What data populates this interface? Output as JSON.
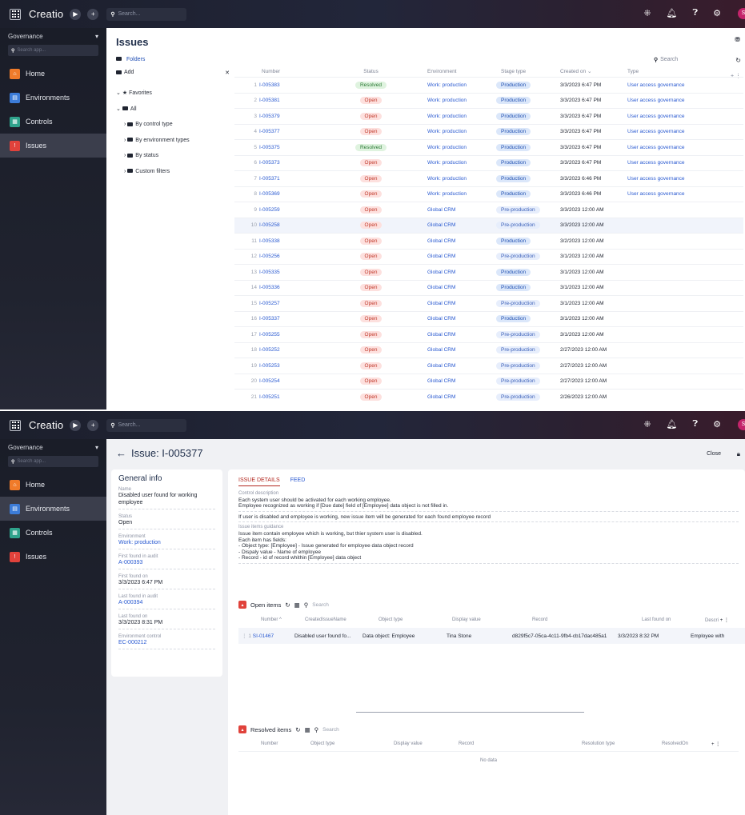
{
  "app": {
    "logo": "Creatio",
    "search_placeholder": "Search...",
    "search_placeholder2": "Search...",
    "avatar": "S"
  },
  "sidebar": {
    "title": "Governance",
    "search_placeholder": "Search app...",
    "items": [
      {
        "label": "Home"
      },
      {
        "label": "Environments"
      },
      {
        "label": "Controls"
      },
      {
        "label": "Issues"
      }
    ]
  },
  "list": {
    "title": "Issues",
    "folders_label": "Folders",
    "add_label": "Add",
    "search_label": "Search",
    "tree": [
      {
        "label": "Favorites"
      },
      {
        "label": "All"
      },
      {
        "label": "By control type"
      },
      {
        "label": "By environment types"
      },
      {
        "label": "By status"
      },
      {
        "label": "Custom filters"
      }
    ],
    "columns": [
      "Number",
      "Status",
      "Environment",
      "Stage type",
      "Created on",
      "Type"
    ],
    "rows": [
      {
        "n": "1",
        "number": "I-005383",
        "status": "Resolved",
        "env": "Work: production",
        "stage": "Production",
        "created": "3/3/2023 6:47 PM",
        "type": "User access governance"
      },
      {
        "n": "2",
        "number": "I-005381",
        "status": "Open",
        "env": "Work: production",
        "stage": "Production",
        "created": "3/3/2023 6:47 PM",
        "type": "User access governance"
      },
      {
        "n": "3",
        "number": "I-005379",
        "status": "Open",
        "env": "Work: production",
        "stage": "Production",
        "created": "3/3/2023 6:47 PM",
        "type": "User access governance"
      },
      {
        "n": "4",
        "number": "I-005377",
        "status": "Open",
        "env": "Work: production",
        "stage": "Production",
        "created": "3/3/2023 6:47 PM",
        "type": "User access governance"
      },
      {
        "n": "5",
        "number": "I-005375",
        "status": "Resolved",
        "env": "Work: production",
        "stage": "Production",
        "created": "3/3/2023 6:47 PM",
        "type": "User access governance"
      },
      {
        "n": "6",
        "number": "I-005373",
        "status": "Open",
        "env": "Work: production",
        "stage": "Production",
        "created": "3/3/2023 6:47 PM",
        "type": "User access governance"
      },
      {
        "n": "7",
        "number": "I-005371",
        "status": "Open",
        "env": "Work: production",
        "stage": "Production",
        "created": "3/3/2023 6:46 PM",
        "type": "User access governance"
      },
      {
        "n": "8",
        "number": "I-005369",
        "status": "Open",
        "env": "Work: production",
        "stage": "Production",
        "created": "3/3/2023 6:46 PM",
        "type": "User access governance"
      },
      {
        "n": "9",
        "number": "I-005259",
        "status": "Open",
        "env": "Global CRM",
        "stage": "Pre-production",
        "created": "3/3/2023 12:00 AM",
        "type": ""
      },
      {
        "n": "10",
        "number": "I-005258",
        "status": "Open",
        "env": "Global CRM",
        "stage": "Pre-production",
        "created": "3/3/2023 12:00 AM",
        "type": ""
      },
      {
        "n": "11",
        "number": "I-005338",
        "status": "Open",
        "env": "Global CRM",
        "stage": "Production",
        "created": "3/2/2023 12:00 AM",
        "type": ""
      },
      {
        "n": "12",
        "number": "I-005256",
        "status": "Open",
        "env": "Global CRM",
        "stage": "Pre-production",
        "created": "3/1/2023 12:00 AM",
        "type": ""
      },
      {
        "n": "13",
        "number": "I-005335",
        "status": "Open",
        "env": "Global CRM",
        "stage": "Production",
        "created": "3/1/2023 12:00 AM",
        "type": ""
      },
      {
        "n": "14",
        "number": "I-005336",
        "status": "Open",
        "env": "Global CRM",
        "stage": "Production",
        "created": "3/1/2023 12:00 AM",
        "type": ""
      },
      {
        "n": "15",
        "number": "I-005257",
        "status": "Open",
        "env": "Global CRM",
        "stage": "Pre-production",
        "created": "3/1/2023 12:00 AM",
        "type": ""
      },
      {
        "n": "16",
        "number": "I-005337",
        "status": "Open",
        "env": "Global CRM",
        "stage": "Production",
        "created": "3/1/2023 12:00 AM",
        "type": ""
      },
      {
        "n": "17",
        "number": "I-005255",
        "status": "Open",
        "env": "Global CRM",
        "stage": "Pre-production",
        "created": "3/1/2023 12:00 AM",
        "type": ""
      },
      {
        "n": "18",
        "number": "I-005252",
        "status": "Open",
        "env": "Global CRM",
        "stage": "Pre-production",
        "created": "2/27/2023 12:00 AM",
        "type": ""
      },
      {
        "n": "19",
        "number": "I-005253",
        "status": "Open",
        "env": "Global CRM",
        "stage": "Pre-production",
        "created": "2/27/2023 12:00 AM",
        "type": ""
      },
      {
        "n": "20",
        "number": "I-005254",
        "status": "Open",
        "env": "Global CRM",
        "stage": "Pre-production",
        "created": "2/27/2023 12:00 AM",
        "type": ""
      },
      {
        "n": "21",
        "number": "I-005251",
        "status": "Open",
        "env": "Global CRM",
        "stage": "Pre-production",
        "created": "2/26/2023 12:00 AM",
        "type": ""
      }
    ]
  },
  "detail": {
    "title": "Issue: I-005377",
    "close_label": "Close",
    "general_title": "General info",
    "fields": [
      {
        "label": "Name",
        "value": "Disabled user found for working employee",
        "link": false
      },
      {
        "label": "Status",
        "value": "Open",
        "link": false
      },
      {
        "label": "Environment",
        "value": "Work: production",
        "link": true
      },
      {
        "label": "First found in audit",
        "value": "A-000393",
        "link": true
      },
      {
        "label": "First found on",
        "value": "3/3/2023 6:47 PM",
        "link": false
      },
      {
        "label": "Last found in audit",
        "value": "A-000394",
        "link": true
      },
      {
        "label": "Last found on",
        "value": "3/3/2023 8:31 PM",
        "link": false
      },
      {
        "label": "Environment control",
        "value": "EC-000212",
        "link": true
      }
    ],
    "tabs": [
      "ISSUE DETAILS",
      "FEED"
    ],
    "cd_label": "Control description",
    "cd_lines": [
      "Each system user should be activated for each working employee.",
      "Employee recognized as working if [Due date] field of [Employee] data object is not filled in."
    ],
    "cd_line3": "If user is disabled and employee is working, new issue item will be generated for each found employee record",
    "ig_label": "Issue items guidance",
    "ig_lines": [
      "Issue item contain employee which is working, but thier system user is disabled.",
      "Each item has fields:",
      "- Object type: [Employee] - Issue generated for employee data object record",
      "- Dispaly value - Name of employee",
      "- Record - id of record whithin [Employee] data object"
    ],
    "open_items_label": "Open items",
    "search_label": "Search",
    "open_cols": [
      "Number ^",
      "CreatedIssueName",
      "Object type",
      "Display value",
      "Record",
      "Last found on",
      "Descri"
    ],
    "open_row": {
      "n": "1",
      "number": "SI-01467",
      "name": "Disabled user found fo...",
      "object": "Data object: Employee",
      "display": "Tina Stone",
      "record": "d829f5c7-05ca-4c11-9fb4-cb17dac485a1",
      "last": "3/3/2023 8:32 PM",
      "descr": "Employee with"
    },
    "resolved_label": "Resolved items",
    "res_cols": [
      "Number",
      "Object type",
      "Display value",
      "Record",
      "Resolution type",
      "ResolvedOn"
    ],
    "no_data": "No data"
  },
  "colors": {
    "accent": "#2a5ad1",
    "open": "#c0392b",
    "resolved": "#2b7a35",
    "home": "#f07b2a",
    "environments": "#3c7cd8",
    "controls": "#2fa38c",
    "issues": "#e0423b"
  }
}
